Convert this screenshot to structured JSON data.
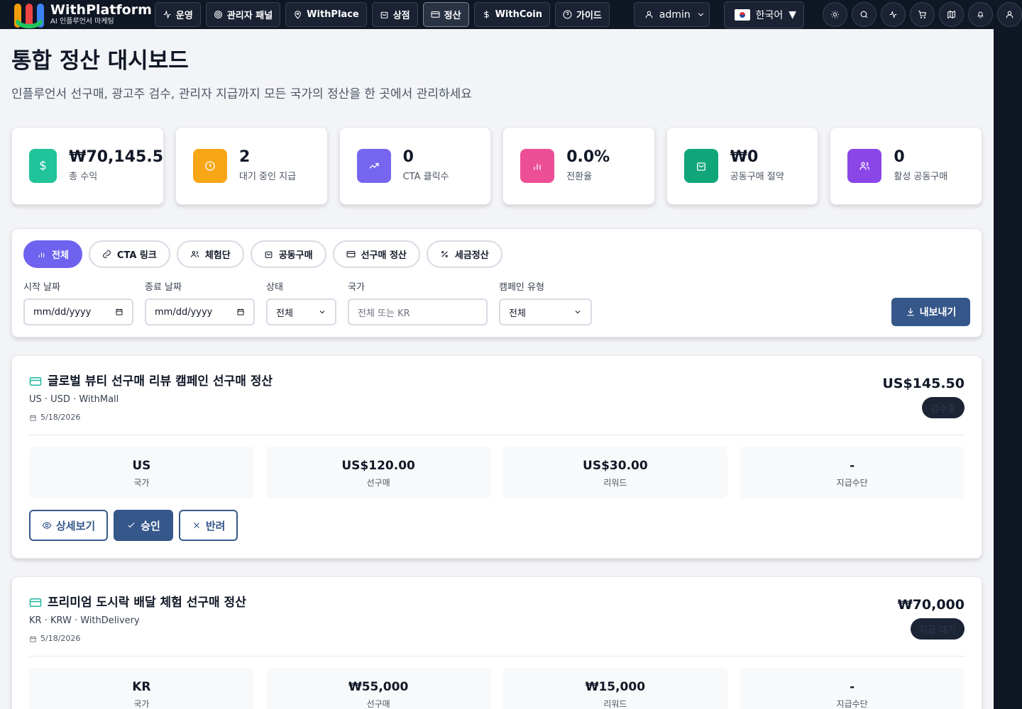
{
  "header": {
    "brand_name": "WithPlatform",
    "brand_sub": "AI 인플루언서 마케팅",
    "nav": [
      {
        "label": "운영",
        "icon": "activity-icon"
      },
      {
        "label": "관리자 패널",
        "icon": "target-icon"
      },
      {
        "label": "WithPlace",
        "icon": "map-pin-icon"
      },
      {
        "label": "상점",
        "icon": "shopping-bag-icon"
      },
      {
        "label": "정산",
        "icon": "credit-card-icon",
        "active": true
      },
      {
        "label": "WithCoin",
        "icon": "dollar-icon"
      },
      {
        "label": "가이드",
        "icon": "help-circle-icon"
      }
    ],
    "user": "admin",
    "language": "한국어",
    "tool_icons": [
      "sun-icon",
      "search-icon",
      "pulse-icon",
      "cart-icon",
      "map-icon",
      "bell-icon",
      "user-icon"
    ]
  },
  "page": {
    "title": "통합 정산 대시보드",
    "subtitle": "인플루언서 선구매, 광고주 검수, 관리자 지급까지 모든 국가의 정산을 한 곳에서 관리하세요"
  },
  "stats": [
    {
      "value": "₩70,145.5",
      "label": "총 수익",
      "color": "#20c39a",
      "icon": "dollar-icon"
    },
    {
      "value": "2",
      "label": "대기 중인 지급",
      "color": "#f8a516",
      "icon": "clock-icon"
    },
    {
      "value": "0",
      "label": "CTA 클릭수",
      "color": "#7666ef",
      "icon": "trending-up-icon"
    },
    {
      "value": "0.0%",
      "label": "전환율",
      "color": "#ec4f95",
      "icon": "bar-chart-icon"
    },
    {
      "value": "₩0",
      "label": "공동구매 절약",
      "color": "#10a67a",
      "icon": "shopping-bag-icon"
    },
    {
      "value": "0",
      "label": "활성 공동구매",
      "color": "#8b46e8",
      "icon": "users-icon"
    }
  ],
  "tabs": [
    {
      "label": "전체",
      "icon": "bar-chart-icon",
      "active": true
    },
    {
      "label": "CTA 링크",
      "icon": "link-icon"
    },
    {
      "label": "체험단",
      "icon": "users-icon"
    },
    {
      "label": "공동구매",
      "icon": "shopping-bag-icon"
    },
    {
      "label": "선구매 정산",
      "icon": "credit-card-icon"
    },
    {
      "label": "세금정산",
      "icon": "percent-icon"
    }
  ],
  "filters": {
    "start_label": "시작 날짜",
    "start_value": "mm/dd/yyyy",
    "end_label": "종료 날짜",
    "end_value": "mm/dd/yyyy",
    "status_label": "상태",
    "status_value": "전체",
    "country_label": "국가",
    "country_placeholder": "전체 또는 KR",
    "campaign_label": "캠페인 유형",
    "campaign_value": "전체",
    "export_label": "내보내기"
  },
  "items": [
    {
      "title": "글로벌 뷰티 선구매 리뷰 캠페인 선구매 정산",
      "meta": "US · USD · WithMall",
      "date": "5/18/2026",
      "amount": "US$145.50",
      "status": "검수중",
      "info": [
        {
          "value": "US",
          "label": "국가"
        },
        {
          "value": "US$120.00",
          "label": "선구매"
        },
        {
          "value": "US$30.00",
          "label": "리워드"
        },
        {
          "value": "-",
          "label": "지급수단"
        }
      ],
      "actions": [
        "상세보기",
        "승인",
        "반려"
      ]
    },
    {
      "title": "프리미엄 도시락 배달 체험 선구매 정산",
      "meta": "KR · KRW · WithDelivery",
      "date": "5/18/2026",
      "amount": "₩70,000",
      "status": "지급 대기",
      "info": [
        {
          "value": "KR",
          "label": "국가"
        },
        {
          "value": "₩55,000",
          "label": "선구매"
        },
        {
          "value": "₩15,000",
          "label": "리워드"
        },
        {
          "value": "-",
          "label": "지급수단"
        }
      ]
    }
  ]
}
